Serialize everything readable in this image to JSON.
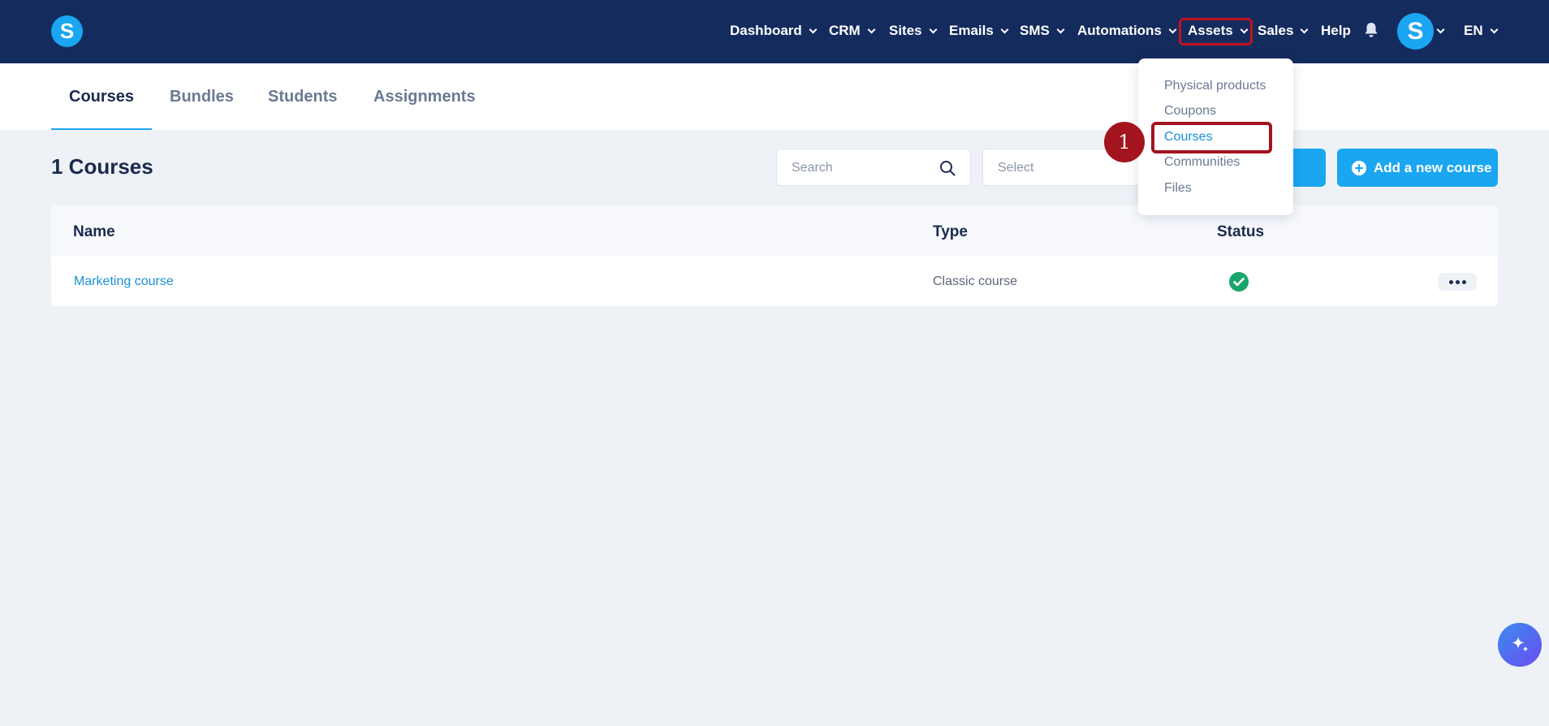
{
  "brand": {
    "logo_letter": "S"
  },
  "nav": {
    "items": [
      {
        "label": "Dashboard"
      },
      {
        "label": "CRM"
      },
      {
        "label": "Sites"
      },
      {
        "label": "Emails"
      },
      {
        "label": "SMS"
      },
      {
        "label": "Automations"
      },
      {
        "label": "Assets"
      },
      {
        "label": "Sales"
      },
      {
        "label": "Help"
      }
    ],
    "avatar_letter": "S",
    "language": "EN",
    "icons": {
      "notifications": "bell-icon"
    }
  },
  "tabs": [
    {
      "label": "Courses",
      "active": true
    },
    {
      "label": "Bundles"
    },
    {
      "label": "Students"
    },
    {
      "label": "Assignments"
    }
  ],
  "page": {
    "heading": "1 Courses",
    "search_placeholder": "Search",
    "select_placeholder": "Select",
    "add_button_label": "Add a new course"
  },
  "table": {
    "columns": [
      "Name",
      "Type",
      "Status"
    ],
    "rows": [
      {
        "name": "Marketing course",
        "type": "Classic course",
        "status": "active"
      }
    ]
  },
  "assets_menu": {
    "items": [
      {
        "label": "Physical products"
      },
      {
        "label": "Coupons"
      },
      {
        "label": "Courses",
        "active": true
      },
      {
        "label": "Communities"
      },
      {
        "label": "Files"
      }
    ]
  },
  "annotation": {
    "step_number": "1"
  },
  "colors": {
    "nav_bg": "#142b5e",
    "accent": "#1aa6f0",
    "highlight": "#a3141e",
    "status_ok": "#1aa56b"
  }
}
